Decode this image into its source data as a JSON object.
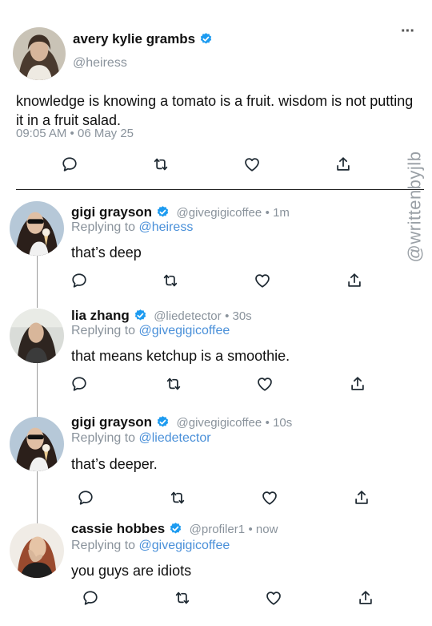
{
  "main_post": {
    "author_name": "avery kylie grambs",
    "handle": "@heiress",
    "text": "knowledge is knowing a tomato is a fruit. wisdom is not putting it in a fruit salad.",
    "time": "09:05 AM",
    "date": "06 May 25",
    "more_label": "···"
  },
  "watermark": "@writtenbyjlb",
  "replies": [
    {
      "author_name": "gigi grayson",
      "handle": "@givegigicoffee",
      "time": "1m",
      "replying_prefix": "Replying to",
      "replying_to": "@heiress",
      "text": "that’s deep"
    },
    {
      "author_name": "lia zhang",
      "handle": "@liedetector",
      "time": "30s",
      "replying_prefix": "Replying to",
      "replying_to": "@givegigicoffee",
      "text": "that means ketchup is a smoothie."
    },
    {
      "author_name": "gigi grayson",
      "handle": "@givegigicoffee",
      "time": "10s",
      "replying_prefix": "Replying to",
      "replying_to": "@liedetector",
      "text": "that’s deeper."
    },
    {
      "author_name": "cassie hobbes",
      "handle": "@profiler1",
      "time": "now",
      "replying_prefix": "Replying to",
      "replying_to": "@givegigicoffee",
      "text": "you guys are idiots"
    }
  ],
  "icons": {
    "reply": "reply-icon",
    "retweet": "retweet-icon",
    "like": "heart-icon",
    "share": "share-icon",
    "verified": "verified-badge-icon"
  },
  "colors": {
    "accent": "#4a90d9",
    "muted": "#8a939c",
    "verified": "#1d9bf0"
  }
}
